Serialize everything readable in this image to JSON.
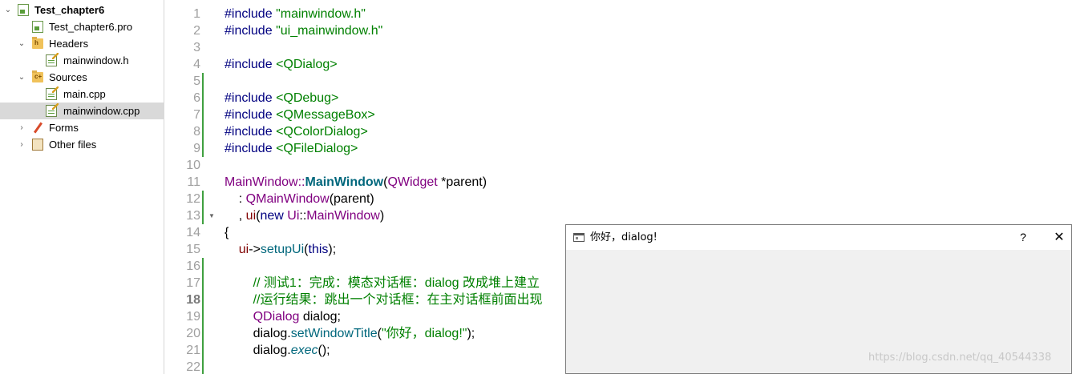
{
  "project_tree": {
    "project": "Test_chapter6",
    "pro_file": "Test_chapter6.pro",
    "headers": {
      "label": "Headers",
      "items": [
        "mainwindow.h"
      ]
    },
    "sources": {
      "label": "Sources",
      "items": [
        "main.cpp",
        "mainwindow.cpp"
      ]
    },
    "forms": "Forms",
    "other_files": "Other files",
    "selected": "mainwindow.cpp"
  },
  "editor": {
    "current_line": 18,
    "line_numbers": [
      "1",
      "2",
      "3",
      "4",
      "5",
      "6",
      "7",
      "8",
      "9",
      "10",
      "11",
      "12",
      "13",
      "14",
      "15",
      "16",
      "17",
      "18",
      "19",
      "20",
      "21",
      "22"
    ],
    "code": {
      "l1": {
        "kw": "#include",
        "str": "\"mainwindow.h\""
      },
      "l2": {
        "kw": "#include",
        "str": "\"ui_mainwindow.h\""
      },
      "l4": {
        "kw": "#include",
        "str": "<QDialog>"
      },
      "l6": {
        "kw": "#include",
        "str": "<QDebug>"
      },
      "l7": {
        "kw": "#include",
        "str": "<QMessageBox>"
      },
      "l8": {
        "kw": "#include",
        "str": "<QColorDialog>"
      },
      "l9": {
        "kw": "#include",
        "str": "<QFileDialog>"
      },
      "l11": {
        "class": "MainWindow",
        "sep": "::",
        "fn": "MainWindow",
        "open": "(",
        "type": "QWidget",
        "rest": " *parent)"
      },
      "l12": {
        "prefix": "    : ",
        "type": "QMainWindow",
        "rest": "(parent)"
      },
      "l13": {
        "prefix": "    , ",
        "mem": "ui",
        "open": "(",
        "new": "new",
        "sp": " ",
        "ns": "Ui",
        "sep": "::",
        "type": "MainWindow",
        "close": ")"
      },
      "l14": "{",
      "l15": {
        "prefix": "    ",
        "mem": "ui",
        "arrow": "->",
        "fn": "setupUi",
        "open": "(",
        "this": "this",
        "close": ");"
      },
      "l17": "        // 测试1：完成：模态对话框：dialog 改成堆上建立",
      "l18": "        //运行结果：跳出一个对话框：在主对话框前面出现",
      "l19": {
        "prefix": "        ",
        "type": "QDialog",
        "rest": " dialog;"
      },
      "l20": {
        "prefix": "        dialog.",
        "fn": "setWindowTitle",
        "open": "(",
        "str": "\"你好，dialog!\"",
        "close": ");"
      },
      "l21": {
        "prefix": "        dialog.",
        "fn": "exec",
        "close": "();"
      }
    }
  },
  "dialog": {
    "title": "你好，dialog!",
    "help": "?",
    "close": "✕"
  },
  "watermark": "https://blog.csdn.net/qq_40544338"
}
